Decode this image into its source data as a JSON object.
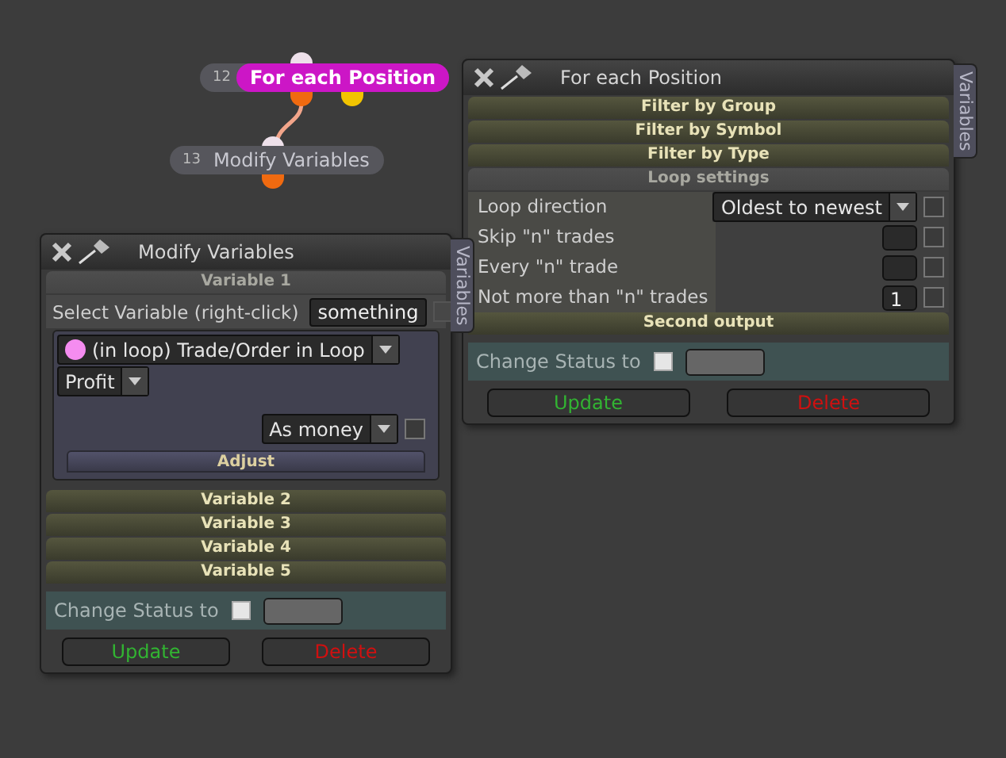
{
  "nodes": [
    {
      "number": "12",
      "title": "For each Position",
      "selected": true
    },
    {
      "number": "13",
      "title": "Modify Variables",
      "selected": false
    }
  ],
  "loop_window": {
    "title": "For each Position",
    "side_tab": "Variables",
    "sections": [
      {
        "label": "Filter by Group",
        "expanded": false
      },
      {
        "label": "Filter by Symbol",
        "expanded": false
      },
      {
        "label": "Filter by Type",
        "expanded": false
      },
      {
        "label": "Loop settings",
        "expanded": true
      }
    ],
    "rows": [
      {
        "label": "Loop direction",
        "kind": "dropdown",
        "value": "Oldest to newest",
        "checked": false
      },
      {
        "label": "Skip \"n\" trades",
        "kind": "number",
        "value": "",
        "checked": false
      },
      {
        "label": "Every \"n\" trade",
        "kind": "number",
        "value": "",
        "checked": false
      },
      {
        "label": "Not more than \"n\" trades",
        "kind": "number",
        "value": "1",
        "checked": false
      }
    ],
    "after_sections": [
      {
        "label": "Second output",
        "expanded": false
      }
    ],
    "status": {
      "label": "Change Status to",
      "checked": false
    },
    "buttons": [
      {
        "label": "Update",
        "kind": "update"
      },
      {
        "label": "Delete",
        "kind": "delete"
      }
    ]
  },
  "modify_window": {
    "title": "Modify Variables",
    "side_tab": "Variables",
    "sections": [
      {
        "label": "Variable 1",
        "expanded": true
      }
    ],
    "select": {
      "label": "Select Variable (right-click)",
      "value": "something",
      "checked": false
    },
    "source": {
      "text": "(in loop) Trade/Order in Loop",
      "color": "#f58cf0"
    },
    "property": "Profit",
    "format": {
      "value": "As money",
      "checked": false
    },
    "adjust": "Adjust",
    "after_sections": [
      {
        "label": "Variable 2",
        "expanded": false
      },
      {
        "label": "Variable 3",
        "expanded": false
      },
      {
        "label": "Variable 4",
        "expanded": false
      },
      {
        "label": "Variable 5",
        "expanded": false
      }
    ],
    "status": {
      "label": "Change Status to",
      "checked": false
    },
    "buttons": [
      {
        "label": "Update",
        "kind": "update"
      },
      {
        "label": "Delete",
        "kind": "delete"
      }
    ]
  }
}
